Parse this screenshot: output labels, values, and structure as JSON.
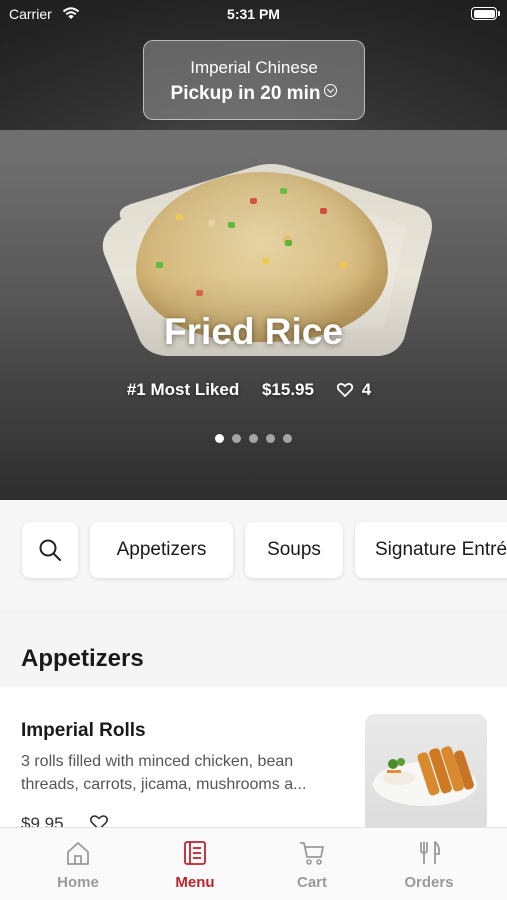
{
  "status_bar": {
    "carrier": "Carrier",
    "time": "5:31 PM"
  },
  "store": {
    "name": "Imperial Chinese",
    "pickup": "Pickup in 20 min"
  },
  "featured": {
    "title": "Fried Rice",
    "badge": "#1 Most Liked",
    "price": "$15.95",
    "likes": "4",
    "slides": 5,
    "active_slide": 0
  },
  "categories": [
    "Appetizers",
    "Soups",
    "Signature Entrées"
  ],
  "section": {
    "title": "Appetizers"
  },
  "items": [
    {
      "title": "Imperial Rolls",
      "description": "3 rolls filled with minced chicken, bean threads, carrots, jicama, mushrooms a...",
      "price": "$9.95"
    }
  ],
  "tabs": [
    {
      "label": "Home",
      "icon": "home-icon"
    },
    {
      "label": "Menu",
      "icon": "menu-book-icon"
    },
    {
      "label": "Cart",
      "icon": "cart-icon"
    },
    {
      "label": "Orders",
      "icon": "fork-knife-icon"
    }
  ],
  "colors": {
    "accent": "#c0222c",
    "tab_inactive": "#9a9a9a"
  }
}
